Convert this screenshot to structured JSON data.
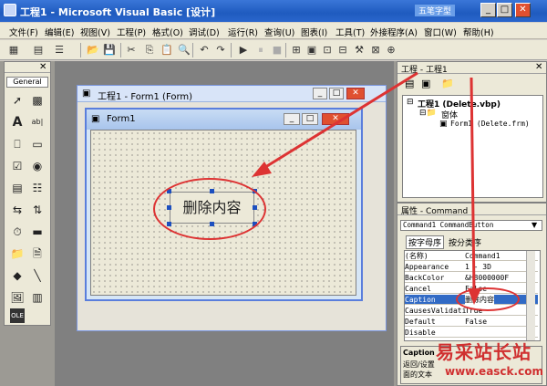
{
  "window": {
    "title": "工程1 - Microsoft Visual Basic [设计]",
    "watermark_top": "五笔字型"
  },
  "menu": [
    "文件(F)",
    "编辑(E)",
    "视图(V)",
    "工程(P)",
    "格式(O)",
    "调试(D)",
    "运行(R)",
    "查询(U)",
    "图表(I)",
    "工具(T)",
    "外接程序(A)",
    "窗口(W)",
    "帮助(H)"
  ],
  "toolbox": {
    "tab": "General"
  },
  "project_window": {
    "title": "工程1 - Form1 (Form)"
  },
  "form_window": {
    "title": "Form1"
  },
  "command_button": {
    "caption": "删除内容"
  },
  "project_panel": {
    "title": "工程 - 工程1",
    "tree": {
      "root": "工程1 (Delete.vbp)",
      "folder": "窗体",
      "item": "Form1 (Delete.frm)"
    }
  },
  "properties_panel": {
    "title": "属性 - Command",
    "object": "Command1 CommandButton",
    "tabs": [
      "按字母序",
      "按分类序"
    ],
    "rows": [
      {
        "name": "(名称)",
        "value": "Command1"
      },
      {
        "name": "Appearance",
        "value": "1 - 3D"
      },
      {
        "name": "BackColor",
        "value": "&H8000000F"
      },
      {
        "name": "Cancel",
        "value": "False"
      },
      {
        "name": "Caption",
        "value": "删除内容"
      },
      {
        "name": "CausesValidati",
        "value": "True"
      },
      {
        "name": "Default",
        "value": "False"
      },
      {
        "name": "Disable",
        "value": ""
      }
    ],
    "desc_title": "Caption",
    "desc_text": "返回/设置",
    "desc_text2": "面的文本"
  },
  "watermark": {
    "brand": "易采站长站",
    "url": "www.easck.com"
  },
  "colors": {
    "annotation": "#dd3333",
    "selection": "#316ac5"
  }
}
